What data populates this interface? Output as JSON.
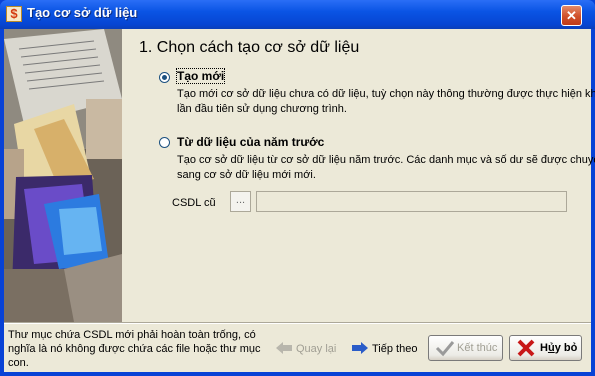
{
  "window": {
    "title": "Tạo cơ sở dữ liệu",
    "app_icon_glyph": "$",
    "close_glyph": "✕"
  },
  "heading": "1. Chọn cách tạo cơ sở dữ liệu",
  "option_new": {
    "label": "Tạo mới",
    "checked": true,
    "description": "Tạo mới cơ sở dữ liệu chưa có dữ liệu, tuỳ chọn này thông thường được thực hiện khi lần đầu tiên sử dụng chương trình."
  },
  "option_previous": {
    "label": "Từ dữ liệu của năm trước",
    "checked": false,
    "description": "Tạo cơ sở dữ liệu từ cơ sở dữ liệu năm trước. Các danh mục và số dư sẽ được chuyển sang cơ sở dữ liệu mới mới."
  },
  "csdl": {
    "label": "CSDL cũ",
    "browse_label": "...",
    "value": ""
  },
  "hint": "Thư mục chứa CSDL mới phải hoàn toàn trống, có nghĩa là nó không được chứa các file hoặc thư mục con.",
  "buttons": {
    "back": "Quay lại",
    "next": "Tiếp theo",
    "finish": "Kết thúc",
    "cancel_prefix": "H",
    "cancel_underlined": "ủ",
    "cancel_suffix": "y bỏ"
  },
  "colors": {
    "titlebar": "#0a54e4",
    "client": "#ece9d8",
    "radio": "#1c5180",
    "cancel_icon": "#c81818",
    "finish_icon": "#9a9a9a",
    "next_arrow": "#2a5cc8"
  }
}
